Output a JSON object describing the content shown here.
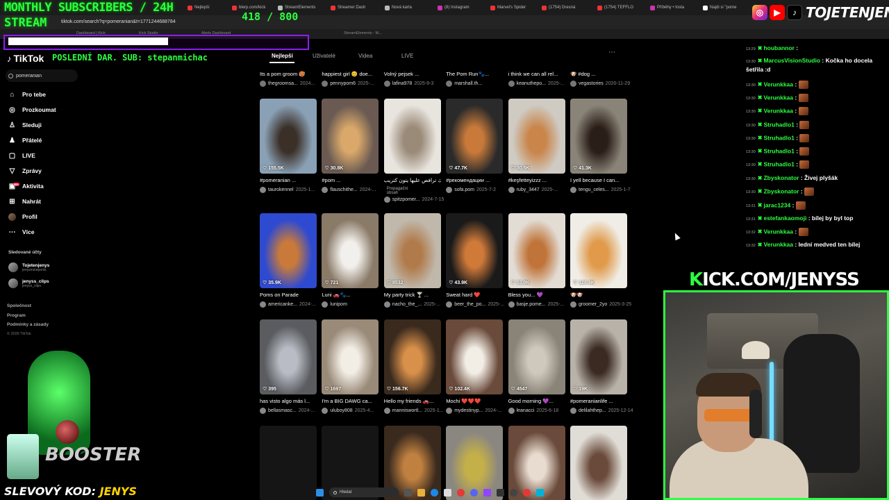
{
  "browser": {
    "tabs": [
      {
        "label": "Nejlepší",
        "color": "#e33"
      },
      {
        "label": "blerp.com/kick",
        "color": "#e33"
      },
      {
        "label": "StreamElements",
        "color": "#bbb"
      },
      {
        "label": "Streamer Dash",
        "color": "#e33"
      },
      {
        "label": "Nová karta",
        "color": "#bbb"
      },
      {
        "label": "(8) Instagram",
        "color": "#c3a"
      },
      {
        "label": "Marvel's Spider",
        "color": "#e33"
      },
      {
        "label": "(1754) Dresná",
        "color": "#e33"
      },
      {
        "label": "(1754) TEFFLO",
        "color": "#e33"
      },
      {
        "label": "Příběhy • Insta",
        "color": "#c3a"
      },
      {
        "label": "Najdi si \"pome",
        "color": "#fff"
      }
    ],
    "url": "tiktok.com/search?q=pomeranian&t=1771244688784",
    "bookmarks": [
      "Dashboard | Kick",
      "Kick Studio",
      "Alerts Dashboard",
      "StreamElements - M..."
    ]
  },
  "overlay": {
    "title_line1": "MONTHLY SUBSCRIBERS / 24H",
    "title_line2": "STREAM",
    "subs_current": "418",
    "subs_goal": "/ 800",
    "last_donation": "POSLEDNÍ DAR. SUB: stepanmichac",
    "social_name": "TOJETENJENYS",
    "kick_prefix": "K",
    "kick_rest": "ICK.COM/JENYSS",
    "promo_label": "SLEVOVÝ KOD:",
    "promo_code": "JENYS",
    "booster_text": "BOOSTER"
  },
  "tiktok": {
    "logo": "TikTok",
    "search_value": "pomeranian",
    "nav": [
      {
        "label": "Pro tebe",
        "icon": "home-icon",
        "glyph": "⌂"
      },
      {
        "label": "Prozkoumat",
        "icon": "compass-icon",
        "glyph": "◎"
      },
      {
        "label": "Sleduji",
        "icon": "following-icon",
        "glyph": "♙"
      },
      {
        "label": "Přátelé",
        "icon": "friends-icon",
        "glyph": "♟"
      },
      {
        "label": "LIVE",
        "icon": "live-icon",
        "glyph": "▢"
      },
      {
        "label": "Zprávy",
        "icon": "messages-icon",
        "glyph": "▽"
      },
      {
        "label": "Aktivita",
        "icon": "activity-icon",
        "glyph": "▣"
      },
      {
        "label": "Nahrát",
        "icon": "upload-icon",
        "glyph": "⊞"
      },
      {
        "label": "Profil",
        "icon": "profile-avatar",
        "glyph": ""
      },
      {
        "label": "Více",
        "icon": "more-icon",
        "glyph": "⋯"
      }
    ],
    "activity_badge": "99+",
    "followed_title": "Sledované účty",
    "followed": [
      {
        "name": "Tojetenjenys",
        "sub": "jenysminepenis"
      },
      {
        "name": "jenyss_clips",
        "sub": "jenyss_clips"
      }
    ],
    "footer": [
      "Společnost",
      "Program",
      "Podmínky a zásady"
    ],
    "copyright": "© 2026 TikTok",
    "result_tabs": [
      "Nejlepší",
      "Uživatelé",
      "Videa",
      "LIVE"
    ],
    "more": "⋯",
    "top_row": [
      {
        "caption": "Its a pom groom 🥵",
        "user": "thegroomsa...",
        "date": "2024..."
      },
      {
        "caption": "happiest girl 😊 doe...",
        "user": "pennypom6",
        "date": "2025-..."
      },
      {
        "caption": "Volný pejsek ...",
        "user": "lafina978",
        "date": "2025-9-3"
      },
      {
        "caption": "The Pom Run🐾...",
        "user": "marshall.th...",
        "date": ""
      },
      {
        "caption": "i think we can all rel...",
        "user": "keanuthepo...",
        "date": "2025-..."
      },
      {
        "caption": "🐶 #dog ...",
        "user": "vegastories",
        "date": "2020-11-29"
      }
    ],
    "rows": [
      [
        {
          "likes": "155.5K",
          "caption": "#pomeranian ...",
          "user": "taurokennel",
          "date": "2025-1...",
          "c1": "#8aa0b5",
          "c2": "#3b3028"
        },
        {
          "likes": "30.8K",
          "caption": "#pom ...",
          "user": "flauschithe...",
          "date": "2024-...",
          "c1": "#6a5a52",
          "c2": "#d9a86a"
        },
        {
          "likes": "",
          "caption": "فك ترافص عليها يتون كتريب...",
          "user": "spitzpomer...",
          "date": "2024-7-15",
          "c1": "#e8e4de",
          "c2": "#9a8a78",
          "extra": "Propagační obsah"
        },
        {
          "likes": "47.7K",
          "caption": "#рекомендации ...",
          "user": "sofa.pom",
          "date": "2025-7-2",
          "c1": "#2a2a2a",
          "c2": "#c97a3a"
        },
        {
          "likes": "30.5K",
          "caption": "#keşfetteyizzz ...",
          "user": "ruby_3447",
          "date": "2025-...",
          "c1": "#cfcac2",
          "c2": "#c9854a"
        },
        {
          "likes": "41.3K",
          "caption": "I yell because I can...",
          "user": "tengu_celes...",
          "date": "2025-1-7",
          "c1": "#8a8478",
          "c2": "#2a1e18"
        }
      ],
      [
        {
          "likes": "35.9K",
          "caption": "Poms on Parade",
          "user": "americanke...",
          "date": "2024-...",
          "c1": "#2e4ad0",
          "c2": "#c97a3a"
        },
        {
          "likes": "721",
          "caption": "Luni 🚗🐾...",
          "user": "lunipom",
          "date": "",
          "c1": "#8a7a68",
          "c2": "#f2f0ec"
        },
        {
          "likes": "8532",
          "caption": "My party trick 🍸 ...",
          "user": "nacho_the_...",
          "date": "2025-...",
          "c1": "#c0b8ab",
          "c2": "#b07a4a"
        },
        {
          "likes": "43.9K",
          "caption": "Sweat hard ❤️",
          "user": "beer_the_po...",
          "date": "2025-...",
          "c1": "#1a1a1a",
          "c2": "#d07a3a"
        },
        {
          "likes": "53.8K",
          "caption": "Bless you... 💜",
          "user": "basje.pome...",
          "date": "2025-...",
          "c1": "#e2dcd4",
          "c2": "#c0743a"
        },
        {
          "likes": "128.4K",
          "caption": "🐶🐶",
          "user": "groomer_2yo",
          "date": "2025-3-25",
          "c1": "#f0ede6",
          "c2": "#e09a4a"
        }
      ],
      [
        {
          "likes": "395",
          "caption": "has visto algo más l...",
          "user": "bellasmasc...",
          "date": "2024-...",
          "c1": "#5a5c60",
          "c2": "#b8bcc4"
        },
        {
          "likes": "1697",
          "caption": "I'm a BIG DAWG ca...",
          "user": "uluboy808",
          "date": "2025-4...",
          "c1": "#9a8a78",
          "c2": "#f2eee6"
        },
        {
          "likes": "156.7K",
          "caption": "Hello my friends 🚗...",
          "user": "manniswortl...",
          "date": "2025-1...",
          "c1": "#3a2a1e",
          "c2": "#d9904a"
        },
        {
          "likes": "102.4K",
          "caption": "Mochi ❤️❤️❤️",
          "user": "mydestinyp...",
          "date": "2024-...",
          "c1": "#6a4a3a",
          "c2": "#f2eee6"
        },
        {
          "likes": "4547",
          "caption": "Good morning 💜...",
          "user": "leanacci",
          "date": "2025-6-18",
          "c1": "#8a8478",
          "c2": "#cfc8bc"
        },
        {
          "likes": "19K",
          "caption": "#pomeranianlife ...",
          "user": "delilahthep...",
          "date": "2025-12-14",
          "c1": "#b8b2a8",
          "c2": "#3a2a22"
        }
      ],
      [
        {
          "likes": "",
          "caption": "",
          "user": "",
          "date": "",
          "c1": "#151515",
          "c2": "#151515"
        },
        {
          "likes": "",
          "caption": "",
          "user": "",
          "date": "",
          "c1": "#151515",
          "c2": "#151515"
        },
        {
          "likes": "",
          "caption": "",
          "user": "",
          "date": "",
          "c1": "#3a2a1e",
          "c2": "#c08040"
        },
        {
          "likes": "",
          "caption": "",
          "user": "",
          "date": "",
          "c1": "#8a8680",
          "c2": "#c4b048"
        },
        {
          "likes": "",
          "caption": "",
          "user": "",
          "date": "",
          "c1": "#6a4a3a",
          "c2": "#e8dcd0"
        },
        {
          "likes": "",
          "caption": "",
          "user": "",
          "date": "",
          "c1": "#e0ddd6",
          "c2": "#6a4a3a"
        }
      ]
    ]
  },
  "chat": [
    {
      "time": "13:29",
      "user": "houbannor",
      "text": "",
      "emote": false
    },
    {
      "time": "13:30",
      "user": "MarcusVisionStudio",
      "text": "Kočka ho docela šetřila :d",
      "emote": false
    },
    {
      "time": "13:30",
      "user": "Verunkkaa",
      "text": "",
      "emote": true
    },
    {
      "time": "13:30",
      "user": "Verunkkaa",
      "text": "",
      "emote": true
    },
    {
      "time": "13:30",
      "user": "Verunkkaa",
      "text": "",
      "emote": true
    },
    {
      "time": "13:30",
      "user": "Struhadlo1",
      "text": "",
      "emote": true
    },
    {
      "time": "13:30",
      "user": "Struhadlo1",
      "text": "",
      "emote": true
    },
    {
      "time": "13:30",
      "user": "Struhadlo1",
      "text": "",
      "emote": true
    },
    {
      "time": "13:30",
      "user": "Struhadlo1",
      "text": "",
      "emote": true
    },
    {
      "time": "13:30",
      "user": "Zbyskonator",
      "text": "Živej plyšák",
      "emote": false
    },
    {
      "time": "13:30",
      "user": "Zbyskonator",
      "text": "",
      "emote": true
    },
    {
      "time": "13:31",
      "user": "jarac1234",
      "text": "",
      "emote": true
    },
    {
      "time": "13:31",
      "user": "estefankaomoji",
      "text": "bílej by byl top",
      "emote": false
    },
    {
      "time": "13:32",
      "user": "Verunkkaa",
      "text": "",
      "emote": true
    },
    {
      "time": "13:32",
      "user": "Verunkkaa",
      "text": "lední medved ten bílej",
      "emote": false
    }
  ],
  "taskbar": {
    "search_placeholder": "Hledat"
  },
  "colors": {
    "accent_green": "#2cff40",
    "kick_purple": "#8a1ff0",
    "tiktok_red": "#fe2c55",
    "bg": "#000000"
  }
}
